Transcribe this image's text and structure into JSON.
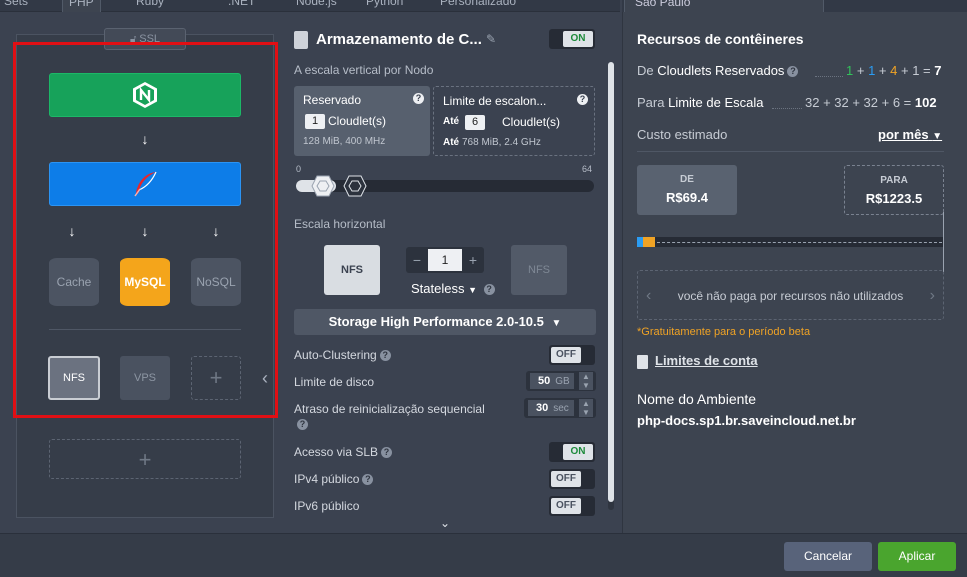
{
  "tabs": {
    "left": [
      "Sets",
      "PHP",
      "Ruby",
      ".NET",
      "Node.js",
      "Python",
      "Personalizado"
    ],
    "right": "São Paulo"
  },
  "topology": {
    "ssl_label": "SSL",
    "nodes": [
      {
        "name": "nginx",
        "icon": "nginx-icon",
        "color": "#17a25a"
      },
      {
        "name": "php",
        "icon": "feather-icon",
        "color": "#0d7de8"
      }
    ],
    "databases": [
      "Cache",
      "MySQL",
      "NoSQL"
    ],
    "storage": [
      "NFS",
      "VPS"
    ],
    "add_symbol": "+"
  },
  "config": {
    "title": "Armazenamento de C...",
    "title_toggle": "ON",
    "vertical_label": "A escala vertical por Nodo",
    "reserved": {
      "head": "Reservado",
      "count": "1",
      "unit": "Cloudlet(s)",
      "detail": "128 MiB, 400 MHz"
    },
    "limit": {
      "head": "Limite de escalon...",
      "prefix": "Até",
      "count": "6",
      "unit": "Cloudlet(s)",
      "detail_prefix": "Até",
      "detail": "768 MiB, 2.4 GHz"
    },
    "slider_min": "0",
    "slider_max": "64",
    "horizontal_label": "Escala horizontal",
    "nodes_count": "1",
    "mode": "Stateless",
    "stack_select": "Storage High Performance 2.0-10.5",
    "nfs_label": "NFS",
    "options": [
      {
        "label": "Auto-Clustering",
        "state": "OFF",
        "help": true
      },
      {
        "label": "Limite de disco",
        "value": "50",
        "unit": "GB"
      },
      {
        "label": "Atraso de reinicialização sequencial",
        "value": "30",
        "unit": "sec",
        "help": true
      },
      {
        "label": "Acesso via SLB",
        "state": "ON",
        "help": true
      },
      {
        "label": "IPv4 público",
        "state": "OFF",
        "help": true
      },
      {
        "label": "IPv6 público",
        "state": "OFF"
      }
    ]
  },
  "resources": {
    "title": "Recursos de contêineres",
    "reserved_label_a": "De",
    "reserved_label_b": "Cloudlets Reservados",
    "reserved_calc": [
      "1",
      "1",
      "4",
      "1"
    ],
    "reserved_total": "7",
    "scale_label_a": "Para",
    "scale_label_b": "Limite de Escala",
    "scale_calc": "32 + 32 + 32 + 6 =",
    "scale_total": "102",
    "cost_label": "Custo estimado",
    "period": "por mês",
    "price_from_label": "DE",
    "price_from": "R$69.4",
    "price_to_label": "PARA",
    "price_to": "R$1223.5",
    "pay_note": "você não paga por recursos não utilizados",
    "beta_note": "*Gratuitamente para o período beta",
    "account_limits": "Limites de conta",
    "env_label": "Nome do Ambiente",
    "env_name": "php-docs.sp1.br.saveincloud.net.br"
  },
  "footer": {
    "cancel": "Cancelar",
    "apply": "Aplicar"
  },
  "colors": {
    "accent_green": "#17a25a",
    "accent_blue": "#0d7de8",
    "highlight_red": "#e10f14",
    "apply_green": "#4aa52e"
  }
}
